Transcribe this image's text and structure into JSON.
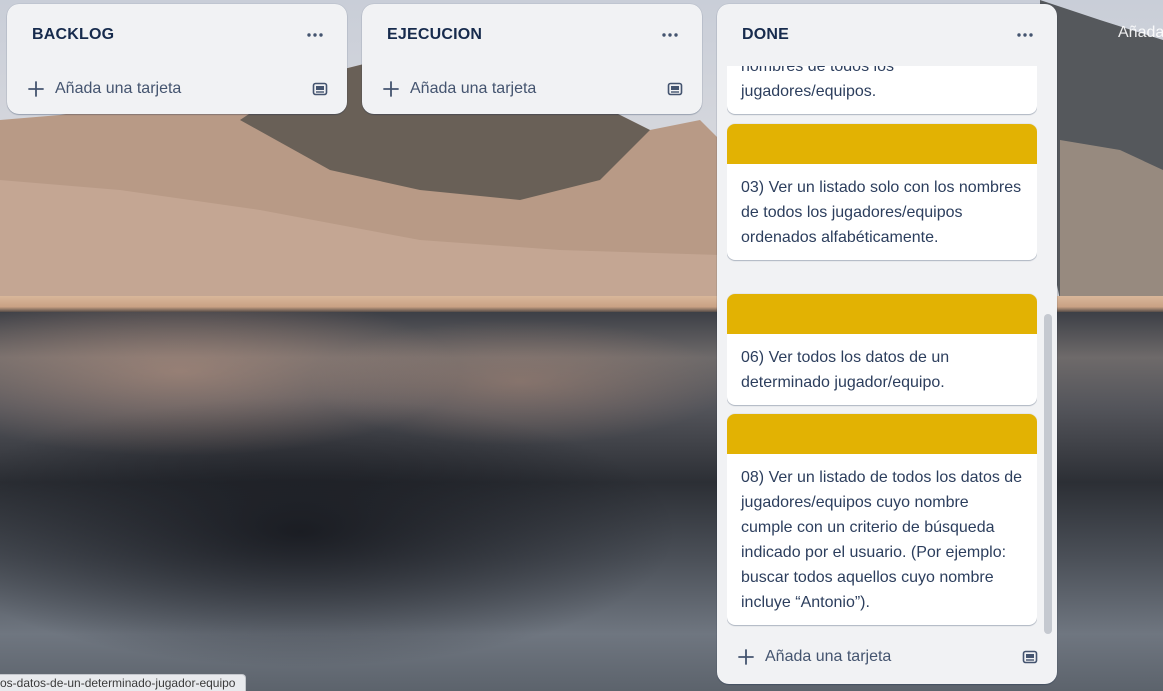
{
  "lists": [
    {
      "title": "BACKLOG",
      "add_label": "Añada una tarjeta"
    },
    {
      "title": "EJECUCION",
      "add_label": "Añada una tarjeta"
    },
    {
      "title": "DONE",
      "add_label": "Añada una tarjeta"
    }
  ],
  "done_cards": [
    {
      "text": "nombres de todos los jugadores/equipos.",
      "cover": false
    },
    {
      "text": "03) Ver un listado solo con los nombres de todos los jugadores/equipos ordenados alfabéticamente.",
      "cover": true
    },
    {
      "text": "06) Ver todos los datos de un determinado jugador/equipo.",
      "cover": true
    },
    {
      "text": "08) Ver un listado de todos los datos de jugadores/equipos cuyo nombre cumple con un criterio de búsqueda indicado por el usuario. (Por ejemplo: buscar todos aquellos cuyo nombre incluye “Antonio”).",
      "cover": true
    }
  ],
  "next_list_add_label": "Añada",
  "status_url": "os-datos-de-un-determinado-jugador-equipo",
  "colors": {
    "cover": "#e2b203",
    "list_bg": "#f1f2f4"
  },
  "icons": [
    "menu-dots-icon",
    "plus-icon",
    "card-template-icon"
  ]
}
